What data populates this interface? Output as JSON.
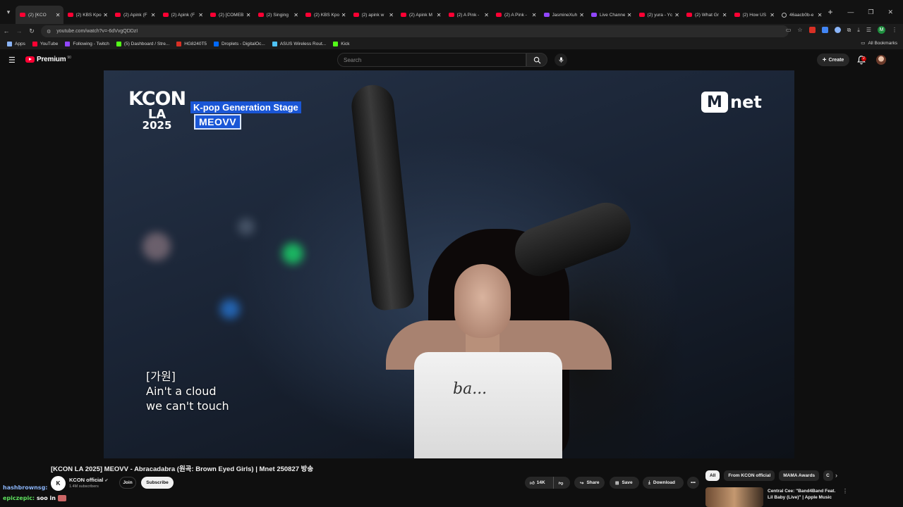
{
  "browser": {
    "tabs": [
      {
        "label": "(2) [KCO",
        "favicon": "youtube",
        "active": true
      },
      {
        "label": "(2) KBS Kpo",
        "favicon": "youtube"
      },
      {
        "label": "(2) Apink (F",
        "favicon": "youtube"
      },
      {
        "label": "(2) Apink (F",
        "favicon": "youtube"
      },
      {
        "label": "(2) [COMEB",
        "favicon": "youtube"
      },
      {
        "label": "(2) Singing",
        "favicon": "youtube"
      },
      {
        "label": "(2) KBS Kpo",
        "favicon": "youtube"
      },
      {
        "label": "(2) apink w",
        "favicon": "youtube"
      },
      {
        "label": "(2) Apink M",
        "favicon": "youtube"
      },
      {
        "label": "(2) A Pink -",
        "favicon": "youtube"
      },
      {
        "label": "(2) A Pink -",
        "favicon": "youtube"
      },
      {
        "label": "JasmineXuh",
        "favicon": "twitch"
      },
      {
        "label": "Live Channe",
        "favicon": "twitch"
      },
      {
        "label": "(2) yura - Yc",
        "favicon": "youtube"
      },
      {
        "label": "(2) What Gr",
        "favicon": "youtube"
      },
      {
        "label": "(2) How US",
        "favicon": "youtube"
      },
      {
        "label": "46aacb0b-e",
        "favicon": "globe"
      }
    ],
    "url": "youtube.com/watch?v=-6dVvgQDDzI",
    "bookmarks": [
      {
        "label": "Apps",
        "color": "#8ab4f8"
      },
      {
        "label": "YouTube",
        "color": "#ff0033"
      },
      {
        "label": "Following - Twitch",
        "color": "#9146ff"
      },
      {
        "label": "(5) Dashboard / Stre...",
        "color": "#53fc18"
      },
      {
        "label": "HG8240T5",
        "color": "#d93025"
      },
      {
        "label": "Droplets - DigitalOc...",
        "color": "#0069ff"
      },
      {
        "label": "ASUS Wireless Rout...",
        "color": "#4fc3f7"
      },
      {
        "label": "Kick",
        "color": "#53fc18"
      }
    ],
    "all_bookmarks": "All Bookmarks",
    "profile_initial": "M"
  },
  "youtube": {
    "logo": "Premium",
    "logo_sup": "90",
    "search_placeholder": "Search",
    "create_label": "Create",
    "notification_count": "2"
  },
  "video": {
    "kcon_line1": "KCON",
    "kcon_line2": "LA",
    "kcon_line3": "2025",
    "stage_caption": "K-pop Generation Stage",
    "group_caption": "MEOVV",
    "broadcaster_m": "M",
    "broadcaster_rest": "net",
    "lyric_1": "[가원]",
    "lyric_2": "Ain't a cloud",
    "lyric_3": "we can't touch",
    "shirt_text": "ba..."
  },
  "info": {
    "title": "[KCON LA 2025] MEOVV - Abracadabra (원곡: Brown Eyed Girls) | Mnet 250827 방송",
    "channel_name": "KCON official",
    "channel_initial": "K",
    "subscribers": "1.4M subscribers",
    "join_label": "Join",
    "subscribe_label": "Subscribe",
    "like_count": "14K",
    "share_label": "Share",
    "save_label": "Save",
    "download_label": "Download"
  },
  "related": {
    "chips": [
      "All",
      "From KCON official",
      "MAMA Awards",
      "C"
    ],
    "first_title": "Central Cee: \"Band4Band Feat. Lil Baby (Live)\" | Apple Music"
  },
  "chat": [
    {
      "user": "hashbrownsg:",
      "message": ""
    },
    {
      "user": "epiczepic:",
      "message": "soo in"
    }
  ]
}
